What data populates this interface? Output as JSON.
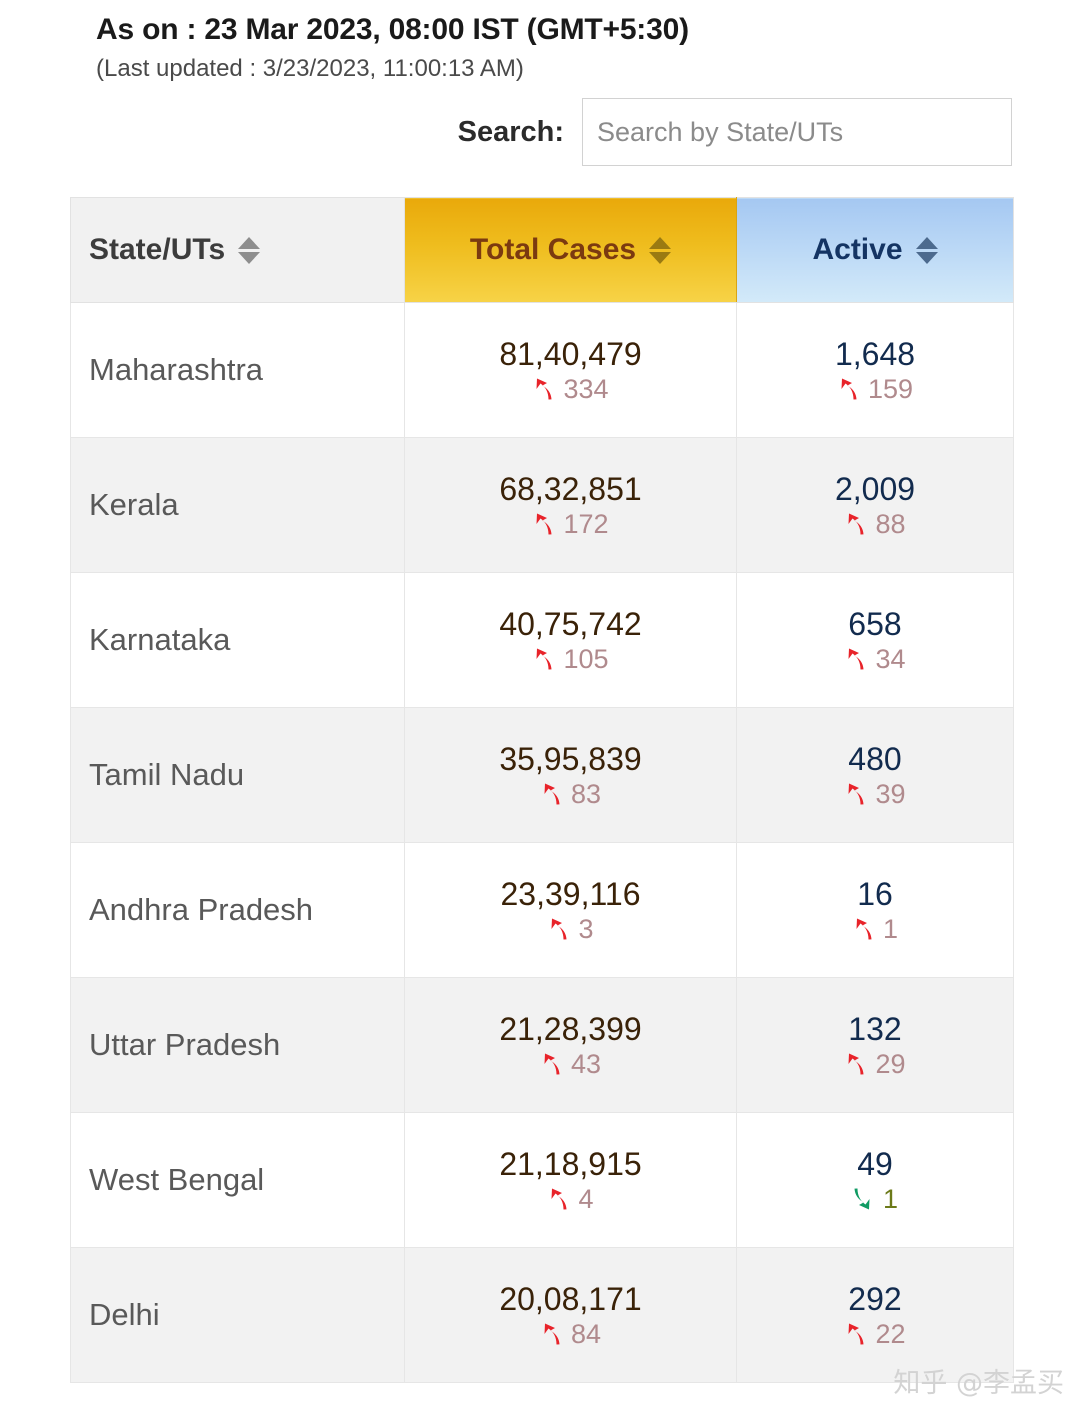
{
  "header": {
    "as_on": "As on : 23 Mar 2023, 08:00 IST (GMT+5:30)",
    "last_updated": "(Last updated : 3/23/2023, 11:00:13 AM)"
  },
  "search": {
    "label": "Search:",
    "value": "",
    "placeholder": "Search by State/UTs"
  },
  "table": {
    "columns": [
      {
        "label": "State/UTs",
        "sort_icon": "sort-updown-icon"
      },
      {
        "label": "Total Cases",
        "sort_icon": "sort-updown-icon"
      },
      {
        "label": "Active",
        "sort_icon": "sort-updown-icon"
      }
    ],
    "rows": [
      {
        "state": "Maharashtra",
        "total": "81,40,479",
        "total_delta": "334",
        "total_dir": "up",
        "active": "1,648",
        "active_delta": "159",
        "active_dir": "up"
      },
      {
        "state": "Kerala",
        "total": "68,32,851",
        "total_delta": "172",
        "total_dir": "up",
        "active": "2,009",
        "active_delta": "88",
        "active_dir": "up"
      },
      {
        "state": "Karnataka",
        "total": "40,75,742",
        "total_delta": "105",
        "total_dir": "up",
        "active": "658",
        "active_delta": "34",
        "active_dir": "up"
      },
      {
        "state": "Tamil Nadu",
        "total": "35,95,839",
        "total_delta": "83",
        "total_dir": "up",
        "active": "480",
        "active_delta": "39",
        "active_dir": "up"
      },
      {
        "state": "Andhra Pradesh",
        "total": "23,39,116",
        "total_delta": "3",
        "total_dir": "up",
        "active": "16",
        "active_delta": "1",
        "active_dir": "up"
      },
      {
        "state": "Uttar Pradesh",
        "total": "21,28,399",
        "total_delta": "43",
        "total_dir": "up",
        "active": "132",
        "active_delta": "29",
        "active_dir": "up"
      },
      {
        "state": "West Bengal",
        "total": "21,18,915",
        "total_delta": "4",
        "total_dir": "up",
        "active": "49",
        "active_delta": "1",
        "active_dir": "down"
      },
      {
        "state": "Delhi",
        "total": "20,08,171",
        "total_delta": "84",
        "total_dir": "up",
        "active": "292",
        "active_delta": "22",
        "active_dir": "up"
      }
    ]
  },
  "watermark": {
    "text": "知乎 @李孟买"
  },
  "colors": {
    "total_header_bg": "#eeb817",
    "total_header_text": "#7b3a10",
    "active_header_bg": "#bcd9f6",
    "active_header_text": "#143463",
    "state_header_bg": "#f1f1f1",
    "delta_up_arrow": "#e8232a",
    "delta_up_text": "#b08a8d",
    "delta_down_arrow": "#0f9b63",
    "delta_down_text": "#6c7a19",
    "row_alt_bg": "#f2f2f2"
  }
}
